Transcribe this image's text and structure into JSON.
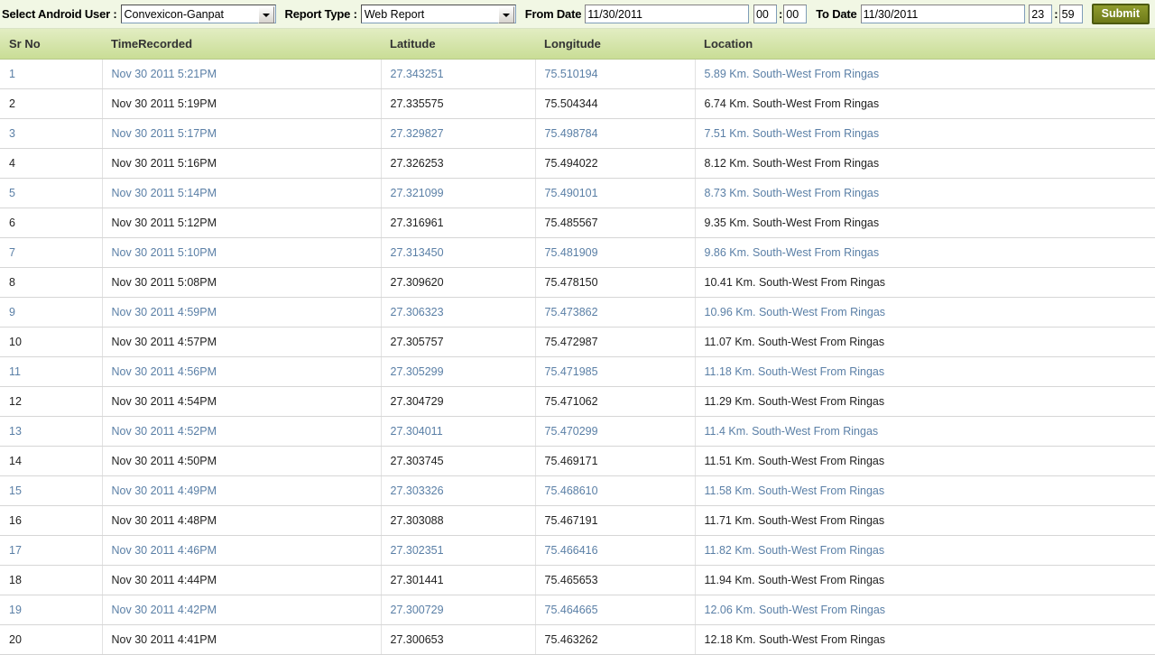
{
  "toolbar": {
    "user_label": "Select Android User :",
    "user_value": "Convexicon-Ganpat",
    "user_options": [
      "Convexicon-Ganpat"
    ],
    "report_label": "Report Type :",
    "report_value": "Web Report",
    "report_options": [
      "Web Report"
    ],
    "from_date_label": "From Date",
    "from_date_value": "11/30/2011",
    "from_hour_value": "00",
    "from_minute_value": "00",
    "to_date_label": "To Date",
    "to_date_value": "11/30/2011",
    "to_hour_value": "23",
    "to_minute_value": "59",
    "time_separator": ":",
    "submit_label": "Submit"
  },
  "table": {
    "columns": [
      "Sr No",
      "TimeRecorded",
      "Latitude",
      "Longitude",
      "Location"
    ],
    "rows": [
      {
        "sr": "1",
        "time": "Nov 30 2011 5:21PM",
        "lat": "27.343251",
        "lon": "75.510194",
        "loc": "5.89 Km. South-West From Ringas"
      },
      {
        "sr": "2",
        "time": "Nov 30 2011 5:19PM",
        "lat": "27.335575",
        "lon": "75.504344",
        "loc": "6.74 Km. South-West From Ringas"
      },
      {
        "sr": "3",
        "time": "Nov 30 2011 5:17PM",
        "lat": "27.329827",
        "lon": "75.498784",
        "loc": "7.51 Km. South-West From Ringas"
      },
      {
        "sr": "4",
        "time": "Nov 30 2011 5:16PM",
        "lat": "27.326253",
        "lon": "75.494022",
        "loc": "8.12 Km. South-West From Ringas"
      },
      {
        "sr": "5",
        "time": "Nov 30 2011 5:14PM",
        "lat": "27.321099",
        "lon": "75.490101",
        "loc": "8.73 Km. South-West From Ringas"
      },
      {
        "sr": "6",
        "time": "Nov 30 2011 5:12PM",
        "lat": "27.316961",
        "lon": "75.485567",
        "loc": "9.35 Km. South-West From Ringas"
      },
      {
        "sr": "7",
        "time": "Nov 30 2011 5:10PM",
        "lat": "27.313450",
        "lon": "75.481909",
        "loc": "9.86 Km. South-West From Ringas"
      },
      {
        "sr": "8",
        "time": "Nov 30 2011 5:08PM",
        "lat": "27.309620",
        "lon": "75.478150",
        "loc": "10.41 Km. South-West From Ringas"
      },
      {
        "sr": "9",
        "time": "Nov 30 2011 4:59PM",
        "lat": "27.306323",
        "lon": "75.473862",
        "loc": "10.96 Km. South-West From Ringas"
      },
      {
        "sr": "10",
        "time": "Nov 30 2011 4:57PM",
        "lat": "27.305757",
        "lon": "75.472987",
        "loc": "11.07 Km. South-West From Ringas"
      },
      {
        "sr": "11",
        "time": "Nov 30 2011 4:56PM",
        "lat": "27.305299",
        "lon": "75.471985",
        "loc": "11.18 Km. South-West From Ringas"
      },
      {
        "sr": "12",
        "time": "Nov 30 2011 4:54PM",
        "lat": "27.304729",
        "lon": "75.471062",
        "loc": "11.29 Km. South-West From Ringas"
      },
      {
        "sr": "13",
        "time": "Nov 30 2011 4:52PM",
        "lat": "27.304011",
        "lon": "75.470299",
        "loc": "11.4 Km. South-West From Ringas"
      },
      {
        "sr": "14",
        "time": "Nov 30 2011 4:50PM",
        "lat": "27.303745",
        "lon": "75.469171",
        "loc": "11.51 Km. South-West From Ringas"
      },
      {
        "sr": "15",
        "time": "Nov 30 2011 4:49PM",
        "lat": "27.303326",
        "lon": "75.468610",
        "loc": "11.58 Km. South-West From Ringas"
      },
      {
        "sr": "16",
        "time": "Nov 30 2011 4:48PM",
        "lat": "27.303088",
        "lon": "75.467191",
        "loc": "11.71 Km. South-West From Ringas"
      },
      {
        "sr": "17",
        "time": "Nov 30 2011 4:46PM",
        "lat": "27.302351",
        "lon": "75.466416",
        "loc": "11.82 Km. South-West From Ringas"
      },
      {
        "sr": "18",
        "time": "Nov 30 2011 4:44PM",
        "lat": "27.301441",
        "lon": "75.465653",
        "loc": "11.94 Km. South-West From Ringas"
      },
      {
        "sr": "19",
        "time": "Nov 30 2011 4:42PM",
        "lat": "27.300729",
        "lon": "75.464665",
        "loc": "12.06 Km. South-West From Ringas"
      },
      {
        "sr": "20",
        "time": "Nov 30 2011 4:41PM",
        "lat": "27.300653",
        "lon": "75.463262",
        "loc": "12.18 Km. South-West From Ringas"
      }
    ]
  },
  "colors": {
    "header_gradient_top": "#e2edc2",
    "header_gradient_bottom": "#c9dd96",
    "toolbar_bg": "#f1f7e4",
    "link_text": "#5a7fa6",
    "plain_text": "#222222",
    "submit_bg": "#7b8824"
  }
}
